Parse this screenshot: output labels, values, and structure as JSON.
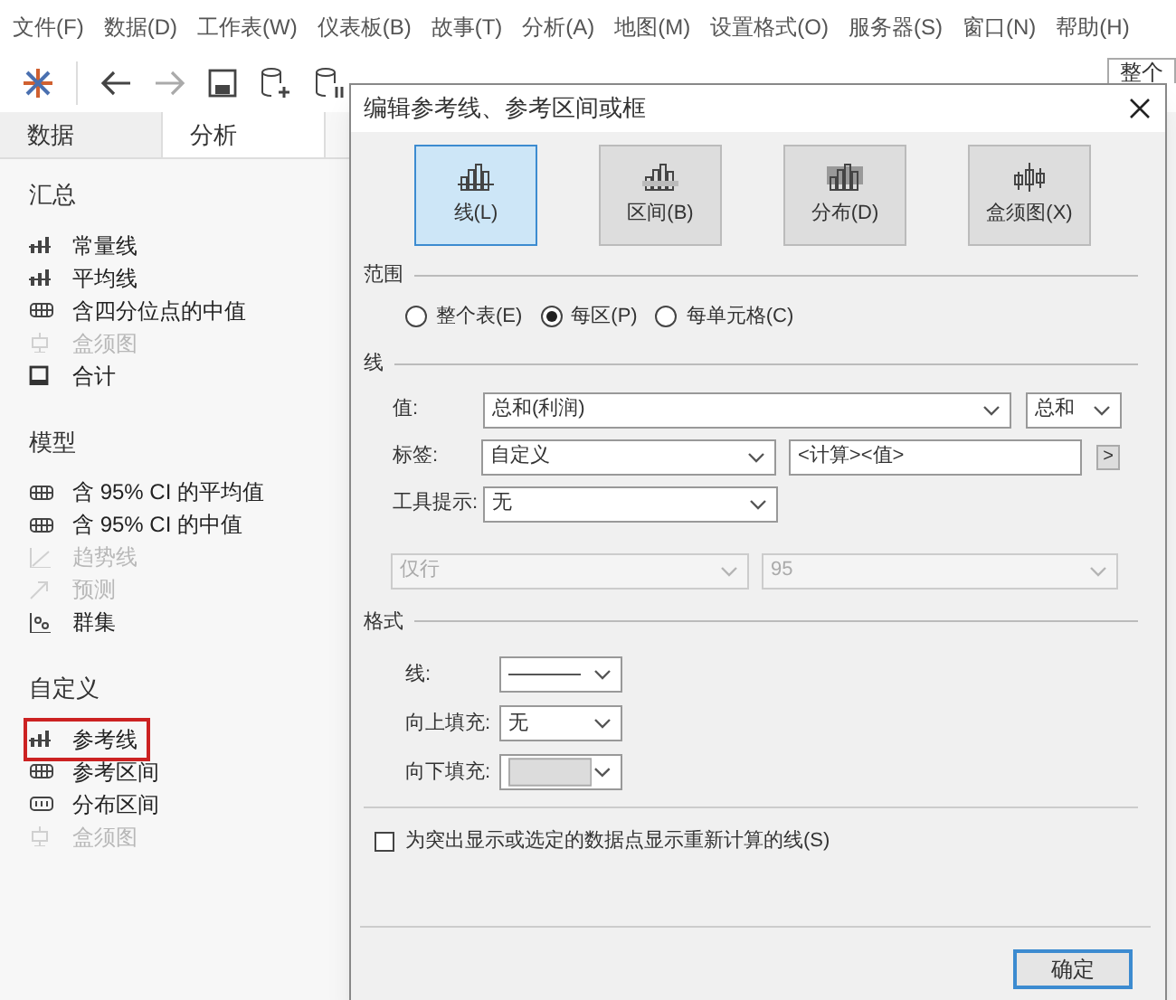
{
  "menu": [
    "文件(F)",
    "数据(D)",
    "工作表(W)",
    "仪表板(B)",
    "故事(T)",
    "分析(A)",
    "地图(M)",
    "设置格式(O)",
    "服务器(S)",
    "窗口(N)",
    "帮助(H)"
  ],
  "toolbar": {
    "view_button": "整个"
  },
  "side_tabs": [
    {
      "label": "数据",
      "selected": false
    },
    {
      "label": "分析",
      "selected": true
    }
  ],
  "sections": [
    {
      "title": "汇总",
      "items": [
        {
          "label": "常量线",
          "kind": "line",
          "disabled": false,
          "selected": false
        },
        {
          "label": "平均线",
          "kind": "line",
          "disabled": false,
          "selected": false
        },
        {
          "label": "含四分位点的中值",
          "kind": "band",
          "disabled": false,
          "selected": false
        },
        {
          "label": "盒须图",
          "kind": "box",
          "disabled": true,
          "selected": false
        },
        {
          "label": "合计",
          "kind": "total",
          "disabled": false,
          "selected": false
        }
      ]
    },
    {
      "title": "模型",
      "items": [
        {
          "label": "含 95% CI 的平均值",
          "kind": "band",
          "disabled": false,
          "selected": false
        },
        {
          "label": "含 95% CI 的中值",
          "kind": "band",
          "disabled": false,
          "selected": false
        },
        {
          "label": "趋势线",
          "kind": "trend",
          "disabled": true,
          "selected": false
        },
        {
          "label": "预测",
          "kind": "forecast",
          "disabled": true,
          "selected": false
        },
        {
          "label": "群集",
          "kind": "cluster",
          "disabled": false,
          "selected": false
        }
      ]
    },
    {
      "title": "自定义",
      "items": [
        {
          "label": "参考线",
          "kind": "line",
          "disabled": false,
          "selected": true
        },
        {
          "label": "参考区间",
          "kind": "band",
          "disabled": false,
          "selected": false
        },
        {
          "label": "分布区间",
          "kind": "dist",
          "disabled": false,
          "selected": false
        },
        {
          "label": "盒须图",
          "kind": "box",
          "disabled": true,
          "selected": false
        }
      ]
    }
  ],
  "dialog": {
    "title": "编辑参考线、参考区间或框",
    "types": [
      {
        "label": "线(L)",
        "selected": true
      },
      {
        "label": "区间(B)",
        "selected": false
      },
      {
        "label": "分布(D)",
        "selected": false
      },
      {
        "label": "盒须图(X)",
        "selected": false
      }
    ],
    "scope": {
      "title": "范围",
      "options": [
        {
          "label": "整个表(E)",
          "selected": false
        },
        {
          "label": "每区(P)",
          "selected": true
        },
        {
          "label": "每单元格(C)",
          "selected": false
        }
      ]
    },
    "line": {
      "title": "线",
      "value_label": "值:",
      "value": "总和(利润)",
      "aggregation": "总和",
      "label_label": "标签:",
      "label_value": "自定义",
      "label_text": "<计算><值>",
      "label_button": ">",
      "tooltip_label": "工具提示:",
      "tooltip_value": "无",
      "disabled_select": "仅行",
      "disabled_value": "95"
    },
    "format": {
      "title": "格式",
      "line_label": "线:",
      "fill_above_label": "向上填充:",
      "fill_above": "无",
      "fill_below_label": "向下填充:"
    },
    "recalc": {
      "label": "为突出显示或选定的数据点显示重新计算的线(S)",
      "checked": false
    },
    "ok_button": "确定"
  }
}
